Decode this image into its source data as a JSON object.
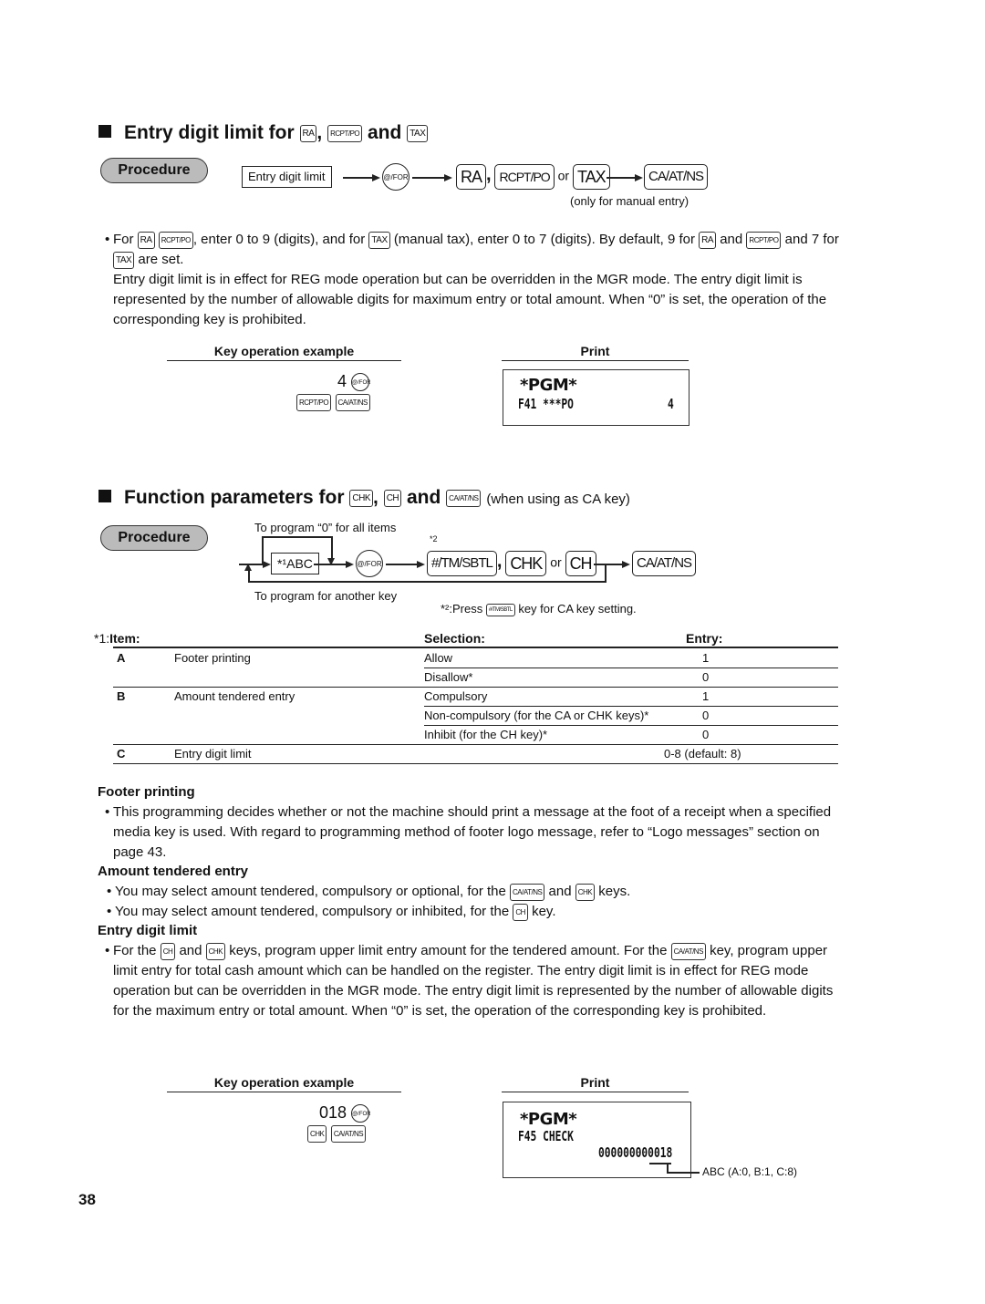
{
  "section1": {
    "title_prefix": "Entry digit limit for",
    "title_key1": "RA",
    "title_key2": "RCPT/PO",
    "title_and": "and",
    "title_key3": "TAX",
    "procedure_label": "Procedure",
    "flow": {
      "box": "Entry digit limit",
      "circle_key": "@/FOR",
      "key_ra": "RA",
      "key_rcpt": "RCPT/PO",
      "or": "or",
      "key_tax": "TAX",
      "key_ca": "CA/AT/NS",
      "note": "(only for manual entry)"
    },
    "bullet": {
      "p1_a": "For",
      "k_ra": "RA",
      "k_rcpt": "RCPT/PO",
      "p1_b": ", enter 0 to 9 (digits), and for",
      "k_tax": "TAX",
      "p1_c": "(manual tax), enter 0 to 7 (digits).  By default, 9 for",
      "p1_d": "and",
      "p1_e": "and 7 for",
      "p1_f": "are set.",
      "p2": "Entry digit limit is in effect for REG mode operation but can be overridden in the MGR mode.  The entry digit limit is represented by the number of allowable digits for maximum entry or total amount.  When “0” is set, the operation of the corresponding key is prohibited."
    },
    "example": {
      "key_op_label": "Key operation example",
      "print_label": "Print",
      "digit": "4",
      "circle_key": "@/FOR",
      "key1": "RCPT/PO",
      "key2": "CA/AT/NS",
      "print_line1": "*PGM*",
      "print_line2": "F41 ***PO",
      "print_value": "4"
    }
  },
  "section2": {
    "title_prefix": "Function parameters for",
    "title_key1": "CHK",
    "title_key2": "CH",
    "title_and": "and",
    "title_key3": "CA/AT/NS",
    "title_suffix": "(when using as CA key)",
    "procedure_label": "Procedure",
    "flow": {
      "loop_top_label": "To program  “0” for all items",
      "loop_bottom_label": "To program for another key",
      "box": "*¹ABC",
      "circle_key": "@/FOR",
      "star2": "*2",
      "key_tm": "#/TM/SBTL",
      "key_chk": "CHK",
      "or": "or",
      "key_ch": "CH",
      "key_ca": "CA/AT/NS",
      "note_prefix": "*²:Press",
      "note_key": "#/TM/SBTL",
      "note_suffix": "key for CA key setting."
    },
    "table": {
      "footnote_mark": "*1:",
      "headers": {
        "item": "Item:",
        "selection": "Selection:",
        "entry": "Entry:"
      },
      "rows": [
        {
          "letter": "A",
          "item": "Footer printing",
          "selection": "Allow",
          "entry": "1"
        },
        {
          "letter": "",
          "item": "",
          "selection": "Disallow*",
          "entry": "0"
        },
        {
          "letter": "B",
          "item": "Amount tendered entry",
          "selection": "Compulsory",
          "entry": "1"
        },
        {
          "letter": "",
          "item": "",
          "selection": "Non-compulsory (for the CA or CHK keys)*",
          "entry": "0"
        },
        {
          "letter": "",
          "item": "",
          "selection": "Inhibit (for the CH key)*",
          "entry": "0"
        },
        {
          "letter": "C",
          "item": "Entry digit limit",
          "selection": "",
          "entry": "0-8 (default: 8)"
        }
      ]
    },
    "footer_printing": {
      "heading": "Footer printing",
      "text": "This programming decides whether or not the machine should print a message at the foot of a receipt when a specified media key is used.  With regard to programming method of footer logo message, refer to “Logo messages” section on page 43."
    },
    "amount_tendered": {
      "heading": "Amount tendered entry",
      "b1_a": "You may select amount tendered, compulsory or optional, for the",
      "b1_k1": "CA/AT/NS",
      "b1_and": "and",
      "b1_k2": "CHK",
      "b1_b": "keys.",
      "b2_a": "You may select amount tendered, compulsory or inhibited, for the",
      "b2_k": "CH",
      "b2_b": "key."
    },
    "entry_digit": {
      "heading": "Entry digit limit",
      "a": "For the",
      "k1": "CH",
      "and": "and",
      "k2": "CHK",
      "b": "keys, program upper limit entry amount for the tendered amount.  For the",
      "k3": "CA/AT/NS",
      "c": "key, program upper limit entry for total cash amount which can be handled on the register.  The entry digit limit is in effect for REG mode operation but can be overridden in the MGR mode.  The entry digit limit is represented by the number of allowable digits for the maximum entry or total amount.  When “0” is set, the operation of the corresponding key is prohibited."
    },
    "example": {
      "key_op_label": "Key operation example",
      "print_label": "Print",
      "digits": "018",
      "circle_key": "@/FOR",
      "key1": "CHK",
      "key2": "CA/AT/NS",
      "print_line1": "*PGM*",
      "print_line2": "F45 CHECK",
      "print_value": "000000000018",
      "callout": "ABC (A:0, B:1, C:8)"
    }
  },
  "page_number": "38"
}
